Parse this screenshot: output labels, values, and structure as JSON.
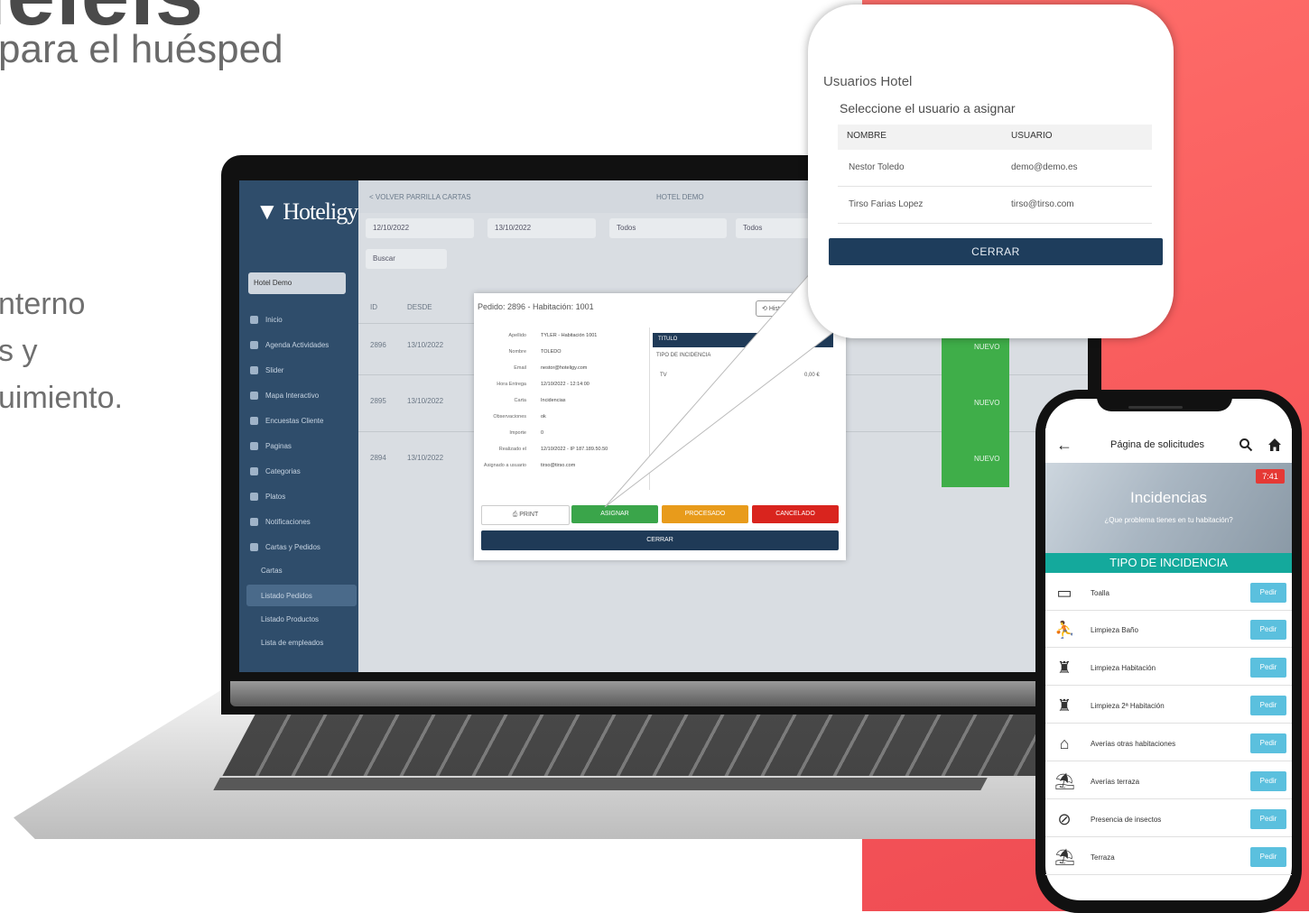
{
  "marketing": {
    "heading_partial": "Ieleis",
    "subtitle": "para el huésped",
    "desc_lines": [
      "nterno",
      "s y",
      "uimiento."
    ]
  },
  "laptop": {
    "logo": "Hoteligy",
    "hotel_select": "Hotel Demo",
    "sidebar": [
      "Inicio",
      "Agenda Actividades",
      "Slider",
      "Mapa Interactivo",
      "Encuestas Cliente",
      "Paginas",
      "Categorias",
      "Platos",
      "Notificaciones",
      "Cartas y Pedidos",
      "Cartas",
      "Listado Pedidos",
      "Listado Productos",
      "Lista de empleados"
    ],
    "topbar_left": "< VOLVER PARRILLA CARTAS",
    "topbar_center": "HOTEL DEMO",
    "filters": [
      "12/10/2022",
      "13/10/2022",
      "Todos",
      "Todos"
    ],
    "search_placeholder": "Buscar",
    "table_headers": [
      "ID",
      "DESDE"
    ],
    "rows": [
      {
        "id": "2896",
        "date": "13/10/2022",
        "status": "NUEVO"
      },
      {
        "id": "2895",
        "date": "13/10/2022",
        "status": "NUEVO"
      },
      {
        "id": "2894",
        "date": "13/10/2022",
        "status": "NUEVO"
      }
    ],
    "modal": {
      "title": "Pedido: 2896 - Habitación: 1001",
      "history_btn": "Historial",
      "fields": [
        {
          "label": "Apellido",
          "value": "TYLER - Habitación 1001"
        },
        {
          "label": "Nombre",
          "value": "TOLEDO"
        },
        {
          "label": "Email",
          "value": "nestor@hoteligy.com"
        },
        {
          "label": "Hora Entrega",
          "value": "12/10/2022 - 12:14:00"
        },
        {
          "label": "Carta",
          "value": "Incidencias"
        },
        {
          "label": "Observaciones",
          "value": "ok"
        },
        {
          "label": "Importe",
          "value": "0"
        },
        {
          "label": "Realizado el",
          "value": "12/10/2022 - IP 187.189.50.50"
        },
        {
          "label": "Asignado a usuario",
          "value": "tirso@tirso.com"
        }
      ],
      "table_header": "TITULO",
      "table_sub": "TIPO DE INCIDENCIA",
      "item": "TV",
      "price": "0,00 €",
      "buttons": [
        "PRINT",
        "ASIGNAR",
        "PROCESADO",
        "CANCELADO"
      ],
      "close": "CERRAR"
    }
  },
  "popup": {
    "title": "Usuarios Hotel",
    "subtitle": "Seleccione el usuario a asignar",
    "headers": [
      "NOMBRE",
      "USUARIO"
    ],
    "rows": [
      {
        "name": "Nestor Toledo",
        "user": "demo@demo.es"
      },
      {
        "name": "Tirso Farias Lopez",
        "user": "tirso@tirso.com"
      }
    ],
    "close": "CERRAR"
  },
  "phone": {
    "header_title": "Página de solicitudes",
    "time_badge": "7:41",
    "hero_title": "Incidencias",
    "hero_sub": "¿Que problema tienes en tu habitación?",
    "section": "TIPO DE INCIDENCIA",
    "button_label": "Pedir",
    "items": [
      {
        "label": "Toalla",
        "icon": "towel-icon"
      },
      {
        "label": "Limpieza Baño",
        "icon": "bath-cleaning-icon"
      },
      {
        "label": "Limpieza Habitación",
        "icon": "room-cleaning-icon"
      },
      {
        "label": "Limpieza 2ª Habitación",
        "icon": "room-cleaning-icon"
      },
      {
        "label": "Averías otras habitaciones",
        "icon": "other-rooms-icon"
      },
      {
        "label": "Averías terraza",
        "icon": "terrace-broken-icon"
      },
      {
        "label": "Presencia de insectos",
        "icon": "no-insects-icon"
      },
      {
        "label": "Terraza",
        "icon": "terrace-icon"
      }
    ]
  }
}
